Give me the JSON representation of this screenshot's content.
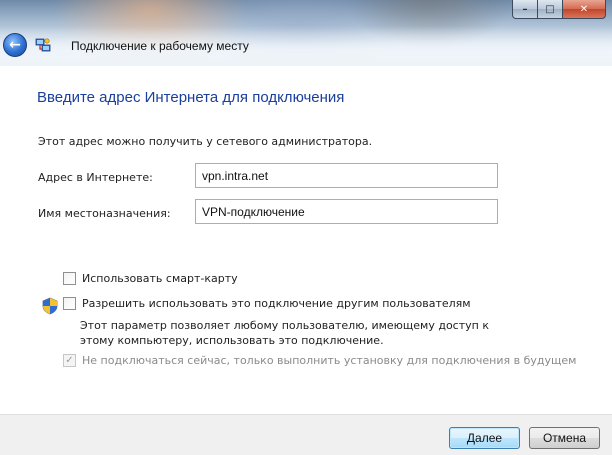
{
  "window": {
    "title": "Подключение к рабочему месту",
    "controls": {
      "minimize": "–",
      "maximize": "□",
      "close": "✕"
    }
  },
  "page": {
    "heading": "Введите адрес Интернета для подключения",
    "description": "Этот адрес можно получить у сетевого администратора."
  },
  "fields": {
    "address": {
      "label": "Адрес в Интернете:",
      "value": "vpn.intra.net"
    },
    "destination": {
      "label": "Имя местоназначения:",
      "value": "VPN-подключение"
    }
  },
  "options": {
    "smart_card": {
      "label": "Использовать смарт-карту",
      "checked": false
    },
    "allow_others": {
      "label": "Разрешить использовать это подключение другим пользователям",
      "checked": false,
      "note": "Этот параметр позволяет любому пользователю, имеющему доступ к этому компьютеру, использовать это подключение."
    },
    "connect_later": {
      "label": "Не подключаться сейчас, только выполнить установку для подключения в будущем",
      "checked": true,
      "disabled": true
    }
  },
  "footer": {
    "next_label": "Далее",
    "cancel_label": "Отмена"
  },
  "icons": {
    "back": "back-arrow-icon",
    "network": "network-connection-icon",
    "shield": "uac-shield-icon"
  },
  "colors": {
    "heading": "#1a3f9c",
    "primary_button_border": "#3c7fb1"
  }
}
